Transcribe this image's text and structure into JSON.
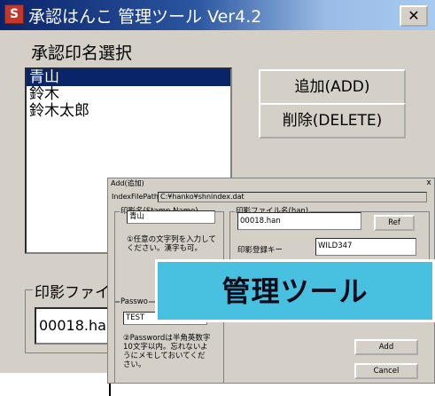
{
  "window": {
    "title": "承認はんこ 管理ツール Ver4.2",
    "icon_char": "S",
    "close_symbol": "✕"
  },
  "main": {
    "list_label": "承認印名選択",
    "list_items": [
      "青山",
      "鈴木",
      "鈴木太郎"
    ],
    "selected_index": 0,
    "add_button": "追加(ADD)",
    "delete_button": "削除(DELETE)",
    "file_group_label": "印影ファイ",
    "file_value": "00018.han"
  },
  "add_dialog": {
    "title": "Add(追加)",
    "close_symbol": "x",
    "index_path_label": "IndexFilePath:",
    "index_path_value": "C:¥hanko¥shnindex.dat",
    "stamp_name_group": "印影名(Stamp Name)",
    "stamp_name_value": "青山",
    "stamp_name_note": "①任意の文字列を入力してください。漢字も可。",
    "file_group": "印影ファイル名(han)",
    "file_value": "00018.han",
    "ref_button": "Ref",
    "key_label": "印影登録キー",
    "key_value": "WILD347",
    "password_group": "Passwo",
    "password_value": "TEST",
    "password_note": "②Passwordは半角英数字10文字以内。忘れないようにメモしておいてください。",
    "add_button": "Add",
    "cancel_button": "Cancel"
  },
  "banner": {
    "text": "管理ツール",
    "color": "#48c0e0"
  },
  "colors": {
    "title_start": "#0a246a",
    "title_end": "#a6caf0",
    "face": "#d4d0c8",
    "selection": "#0a246a"
  }
}
